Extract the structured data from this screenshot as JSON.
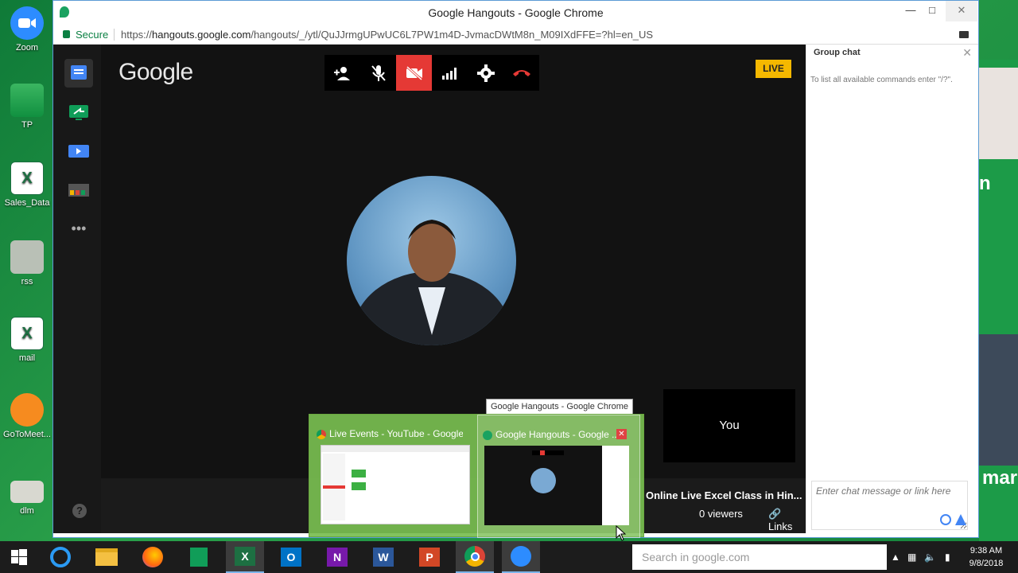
{
  "desktop": {
    "icons": [
      {
        "label": "Zoom"
      },
      {
        "label": "TP"
      },
      {
        "label": "Sales_Data"
      },
      {
        "label": "rss"
      },
      {
        "label": "mail"
      },
      {
        "label": "GoToMeet..."
      },
      {
        "label": "dlm"
      }
    ],
    "right_strip_text": [
      "n",
      "mar"
    ]
  },
  "window": {
    "title": "Google Hangouts - Google Chrome",
    "secure_label": "Secure",
    "url_prefix": "https://",
    "url_domain": "hangouts.google.com",
    "url_path": "/hangouts/_/ytl/QuJJrmgUPwUC6L7PW1m4D-JvmacDWtM8n_M09IXdFFE=?hl=en_US"
  },
  "hangout": {
    "logo": "Google",
    "live_label": "LIVE",
    "you_label": "You",
    "stream_title": "Online Live Excel Class in Hin...",
    "viewers": "0 viewers",
    "links_label": "Links",
    "help": "?"
  },
  "chat": {
    "title": "Group chat",
    "hint": "To list all available commands enter \"/?\".",
    "input_placeholder": "Enter chat message or link here"
  },
  "popup": {
    "tooltip": "Google Hangouts - Google Chrome",
    "thumbs": [
      {
        "label": "Live Events - YouTube - Google ..."
      },
      {
        "label": "Google Hangouts - Google ..."
      }
    ]
  },
  "taskbar": {
    "search_placeholder": "Search in google.com",
    "time": "9:38 AM",
    "date": "9/8/2018"
  },
  "colors": {
    "live": "#f5b800",
    "video_off": "#e53935",
    "desktop": "#1e8a3c"
  }
}
